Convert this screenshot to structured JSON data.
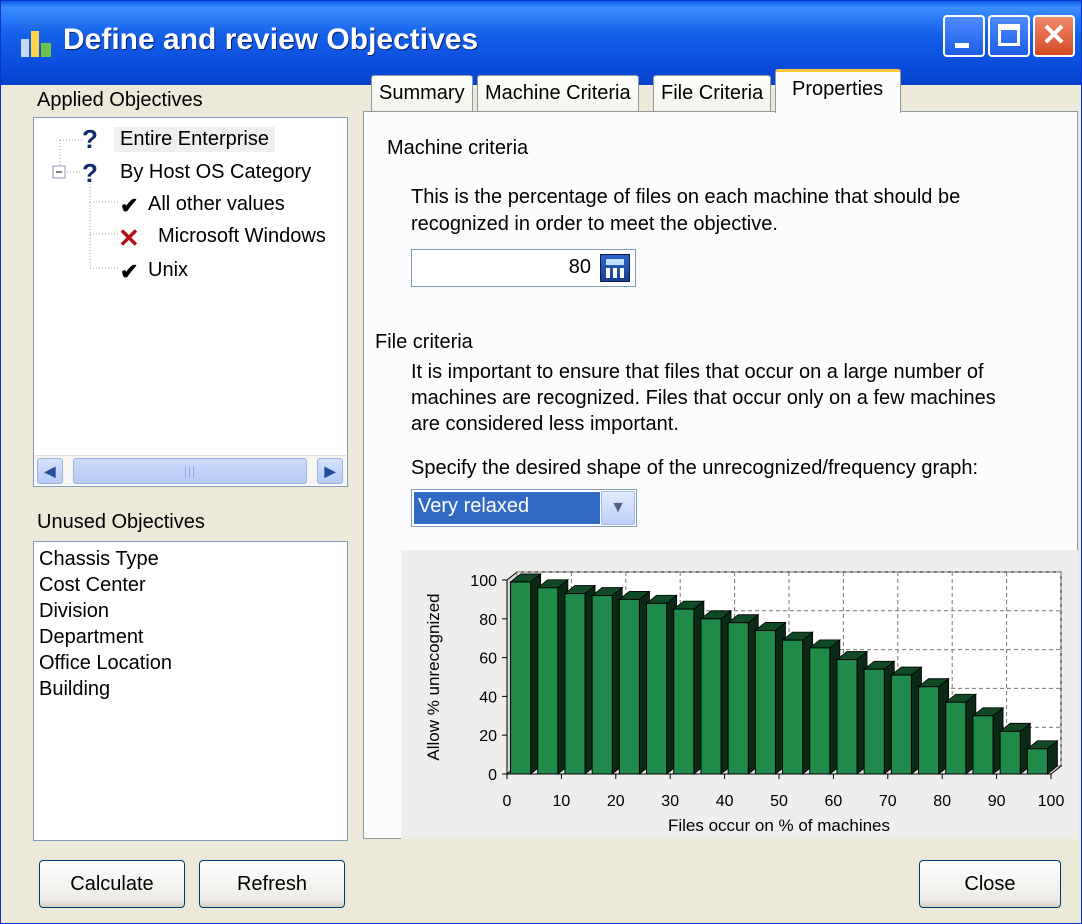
{
  "window": {
    "title": "Define and review Objectives"
  },
  "applied": {
    "label": "Applied Objectives",
    "items": [
      {
        "label": "Entire Enterprise",
        "status": "question"
      },
      {
        "label": "By Host OS Category",
        "status": "question"
      },
      {
        "label": "All other values",
        "status": "check"
      },
      {
        "label": "Microsoft Windows",
        "status": "cross"
      },
      {
        "label": "Unix",
        "status": "check"
      }
    ]
  },
  "unused": {
    "label": "Unused Objectives",
    "items": [
      "Chassis Type",
      "Cost Center",
      "Division",
      "Department",
      "Office Location",
      "Building"
    ]
  },
  "tabs": [
    "Summary",
    "Machine Criteria",
    "File Criteria",
    "Properties"
  ],
  "active_tab": "Properties",
  "machine": {
    "heading": "Machine criteria",
    "desc_line1": "This is the percentage of files on each machine that should be",
    "desc_line2": "recognized in order to meet the objective.",
    "value": "80"
  },
  "file": {
    "heading": "File criteria",
    "desc_line1": "It is important to ensure that files that occur on a large number of",
    "desc_line2": "machines are recognized.  Files that occur only on a few machines",
    "desc_line3": "are considered less important.",
    "shape_label": "Specify the desired shape of the unrecognized/frequency graph:",
    "shape_value": "Very relaxed"
  },
  "chart_data": {
    "type": "bar",
    "xlabel": "Files occur on % of machines",
    "ylabel": "Allow % unrecognized",
    "xlim": [
      0,
      100
    ],
    "ylim": [
      0,
      100
    ],
    "xticks": [
      0,
      10,
      20,
      30,
      40,
      50,
      60,
      70,
      80,
      90,
      100
    ],
    "yticks": [
      0,
      20,
      40,
      60,
      80,
      100
    ],
    "grid": true,
    "x": [
      2.5,
      7.5,
      12.5,
      17.5,
      22.5,
      27.5,
      32.5,
      37.5,
      42.5,
      47.5,
      52.5,
      57.5,
      62.5,
      67.5,
      72.5,
      77.5,
      82.5,
      87.5,
      92.5,
      97.5
    ],
    "values": [
      99,
      96,
      93,
      92,
      90,
      88,
      85,
      80,
      78,
      74,
      69,
      65,
      59,
      54,
      51,
      45,
      37,
      30,
      22,
      13
    ],
    "color": "#1f8a4a"
  },
  "buttons": {
    "calculate": "Calculate",
    "refresh": "Refresh",
    "close": "Close"
  }
}
